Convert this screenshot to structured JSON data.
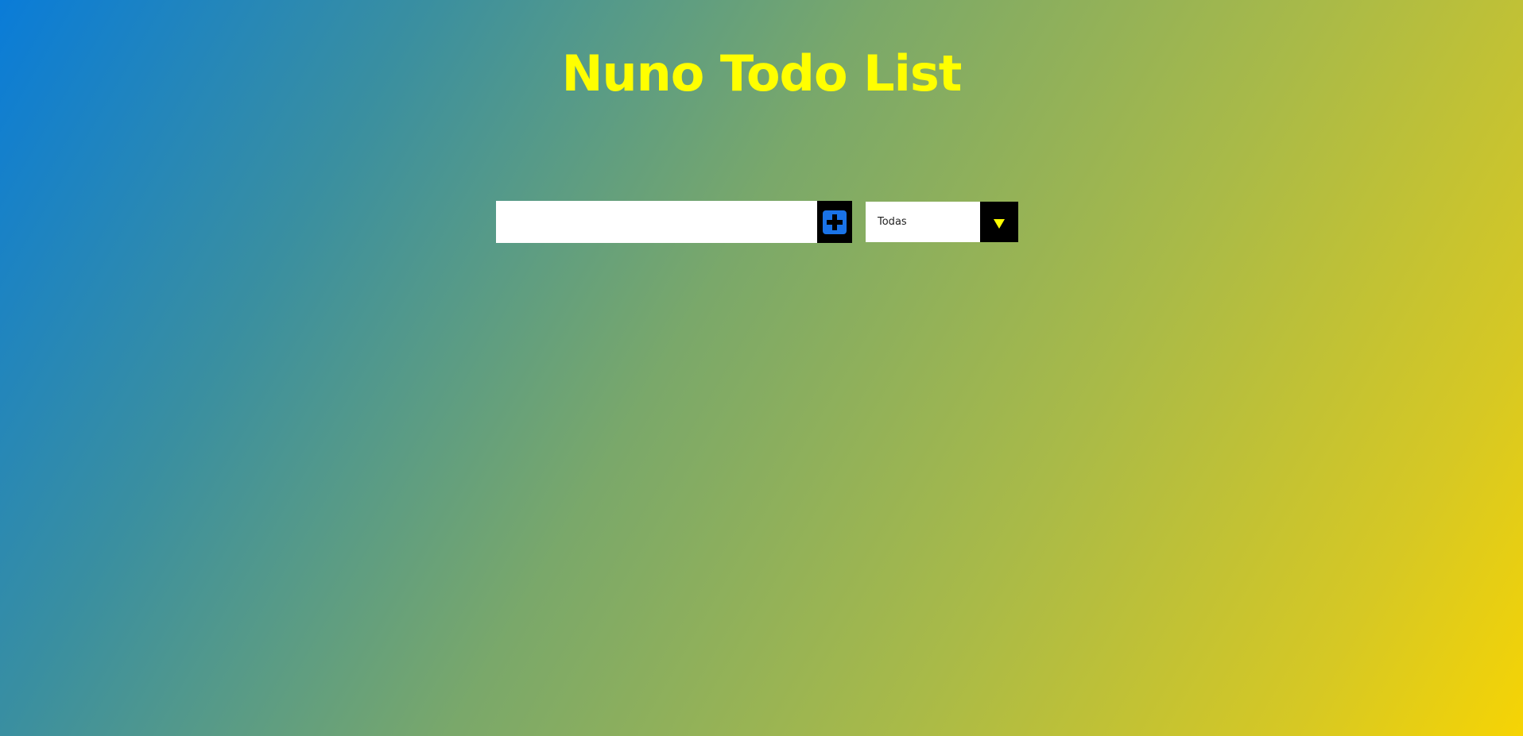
{
  "header": {
    "title": "Nuno Todo List"
  },
  "form": {
    "input_value": "",
    "input_placeholder": "",
    "add_button_icon": "plus-icon"
  },
  "filter": {
    "selected": "Todas",
    "arrow_icon": "triangle-down-icon"
  },
  "todos": [],
  "colors": {
    "title": "#ffff00",
    "gradient_start": "#0a7cd8",
    "gradient_end": "#f6d404",
    "add_icon": "#1a73e8",
    "button_bg": "#000000",
    "arrow": "#ffff00"
  }
}
